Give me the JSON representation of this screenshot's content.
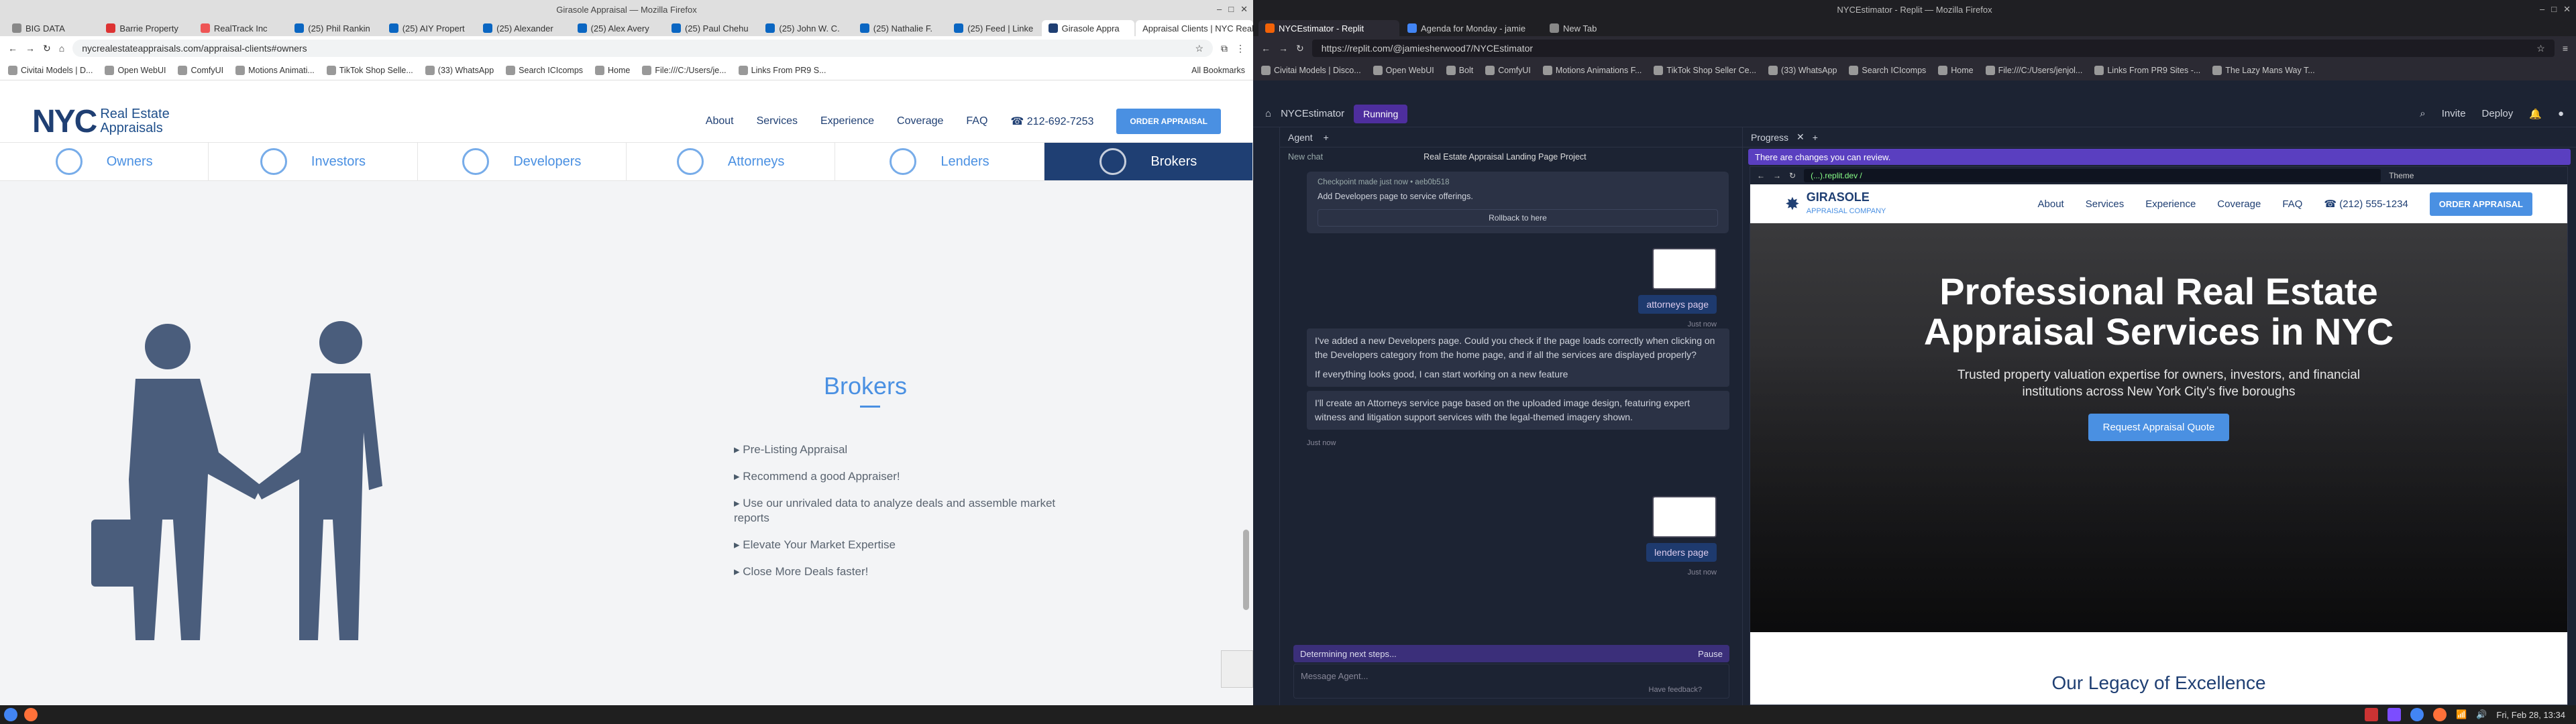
{
  "left": {
    "title": "Girasole Appraisal — Mozilla Firefox",
    "tabs": [
      {
        "label": "BIG DATA",
        "color": "#888"
      },
      {
        "label": "Barrie Property",
        "color": "#d33"
      },
      {
        "label": "RealTrack Inc",
        "color": "#e55"
      },
      {
        "label": "(25) Phil Rankin",
        "color": "#0a66c2"
      },
      {
        "label": "(25) AIY Propert",
        "color": "#0a66c2"
      },
      {
        "label": "(25) Alexander",
        "color": "#0a66c2"
      },
      {
        "label": "(25) Alex Avery",
        "color": "#0a66c2"
      },
      {
        "label": "(25) Paul Chehu",
        "color": "#0a66c2"
      },
      {
        "label": "(25) John W. C.",
        "color": "#0a66c2"
      },
      {
        "label": "(25) Nathalie F.",
        "color": "#0a66c2"
      },
      {
        "label": "(25) Feed | Linke",
        "color": "#0a66c2"
      },
      {
        "label": "Girasole Appra",
        "color": "#1f3f73"
      }
    ],
    "active_tab": "Appraisal Clients | NYC Real E",
    "url": "nycrealestateappraisals.com/appraisal-clients#owners",
    "bookmarks": [
      "Civitai Models | D...",
      "Open WebUI",
      "ComfyUI",
      "Motions Animati...",
      "TikTok Shop Selle...",
      "(33) WhatsApp",
      "Search ICIcomps",
      "Home",
      "File:///C:/Users/je...",
      "Links From PR9 S..."
    ],
    "all_bookmarks": "All Bookmarks",
    "site": {
      "logo_main": "NYC",
      "logo_sub1": "Real Estate",
      "logo_sub2": "Appraisals",
      "nav": [
        "About",
        "Services",
        "Experience",
        "Coverage",
        "FAQ"
      ],
      "phone": "212-692-7253",
      "order": "ORDER APPRAISAL",
      "categories": [
        "Owners",
        "Investors",
        "Developers",
        "Attorneys",
        "Lenders",
        "Brokers"
      ],
      "heading": "Brokers",
      "items": [
        "Pre-Listing Appraisal",
        "Recommend a good Appraiser!",
        "Use our unrivaled data to analyze deals and assemble market reports",
        "Elevate Your Market Expertise",
        "Close More Deals faster!"
      ]
    }
  },
  "right": {
    "title": "NYCEstimator - Replit — Mozilla Firefox",
    "tabs": [
      "NYCEstimator - Replit",
      "Agenda for Monday - jamie",
      "New Tab"
    ],
    "url": "https://replit.com/@jamiesherwood7/NYCEstimator",
    "bookmarks": [
      "Civitai Models | Disco...",
      "Open WebUI",
      "Bolt",
      "ComfyUI",
      "Motions Animations F...",
      "TikTok Shop Seller Ce...",
      "(33) WhatsApp",
      "Search ICIcomps",
      "Home",
      "File:///C:/Users/jenjol...",
      "Links From PR9 Sites -...",
      "The Lazy Mans Way T..."
    ],
    "project": "NYCEstimator",
    "status": "Running",
    "invite": "Invite",
    "deploy": "Deploy",
    "agent_tab": "Agent",
    "new_chat": "New chat",
    "project_title": "Real Estate Appraisal Landing Page Project",
    "checkpoint_meta": "Checkpoint made just now • aeb0b518",
    "checkpoint_msg": "Add Developers page to service offerings.",
    "rollback": "Rollback to here",
    "img1_caption": "attorneys page",
    "just_now": "Just now",
    "ai_msg1": "I've added a new Developers page. Could you check if the page loads correctly when clicking on the Developers category from the home page, and if all the services are displayed properly?",
    "ai_msg2": "If everything looks good, I can start working on a new feature",
    "ai_msg3": "I'll create an Attorneys service page based on the uploaded image design, featuring expert witness and litigation support services with the legal-themed imagery shown.",
    "img2_caption": "lenders page",
    "determining": "Determining next steps...",
    "pause": "Pause",
    "message_placeholder": "Message Agent...",
    "feedback": "Have feedback?",
    "progress_tab": "Progress",
    "changes": "There are changes you can review.",
    "preview_url": "(...).replit.dev  /",
    "theme": "Theme",
    "preview": {
      "brand1": "GIRASOLE",
      "brand2": "APPRAISAL COMPANY",
      "nav": [
        "About",
        "Services",
        "Experience",
        "Coverage",
        "FAQ"
      ],
      "phone": "(212) 555-1234",
      "order": "ORDER APPRAISAL",
      "hero_title": "Professional Real Estate Appraisal Services in NYC",
      "hero_sub": "Trusted property valuation expertise for owners, investors, and financial institutions across New York City's five boroughs",
      "cta": "Request Appraisal Quote",
      "legacy": "Our Legacy of Excellence"
    }
  },
  "clock": "Fri, Feb 28, 13:34"
}
